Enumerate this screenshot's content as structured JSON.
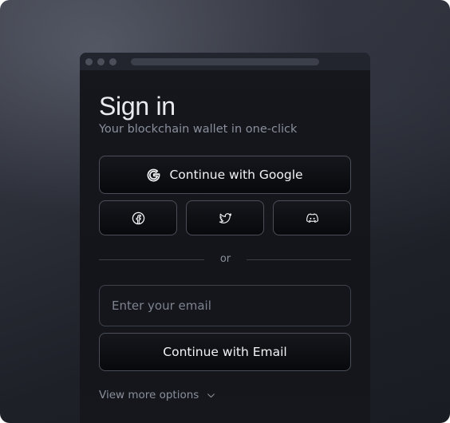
{
  "signin": {
    "title": "Sign in",
    "subtitle": "Your blockchain wallet in one-click",
    "google_button_label": "Continue with Google",
    "divider_text": "or",
    "email_placeholder": "Enter your email",
    "email_value": "",
    "email_button_label": "Continue with Email",
    "more_options_label": "View more options"
  },
  "icons": {
    "google": "google-icon",
    "facebook": "facebook-icon",
    "twitter": "twitter-icon",
    "discord": "discord-icon",
    "more": "chevron-down-icon"
  }
}
